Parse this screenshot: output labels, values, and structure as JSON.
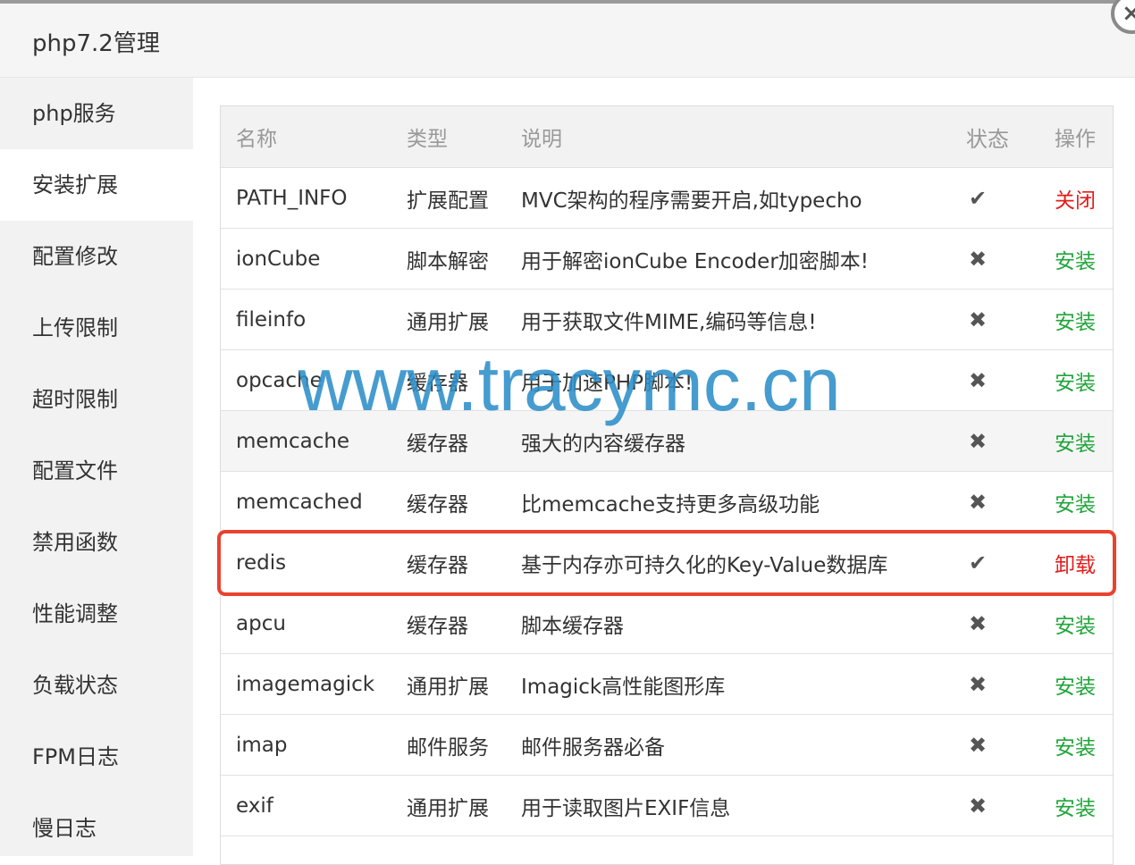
{
  "dialog": {
    "title": "php7.2管理",
    "close_icon": "×"
  },
  "sidebar": {
    "items": [
      {
        "label": "php服务"
      },
      {
        "label": "安装扩展",
        "active": true
      },
      {
        "label": "配置修改"
      },
      {
        "label": "上传限制"
      },
      {
        "label": "超时限制"
      },
      {
        "label": "配置文件"
      },
      {
        "label": "禁用函数"
      },
      {
        "label": "性能调整"
      },
      {
        "label": "负载状态"
      },
      {
        "label": "FPM日志"
      },
      {
        "label": "慢日志"
      }
    ]
  },
  "table": {
    "headers": {
      "name": "名称",
      "type": "类型",
      "desc": "说明",
      "status": "状态",
      "op": "操作"
    },
    "rows": [
      {
        "name": "PATH_INFO",
        "type": "扩展配置",
        "desc": "MVC架构的程序需要开启,如typecho",
        "status": "check",
        "status_glyph": "✔",
        "op": "关闭",
        "op_color": "#e21d1d"
      },
      {
        "name": "ionCube",
        "type": "脚本解密",
        "desc": "用于解密ionCube Encoder加密脚本!",
        "status": "cross",
        "status_glyph": "✖",
        "op": "安装",
        "op_color": "#20a53a"
      },
      {
        "name": "fileinfo",
        "type": "通用扩展",
        "desc": "用于获取文件MIME,编码等信息!",
        "status": "cross",
        "status_glyph": "✖",
        "op": "安装",
        "op_color": "#20a53a"
      },
      {
        "name": "opcache",
        "type": "缓存器",
        "desc": "用于加速PHP脚本!",
        "status": "cross",
        "status_glyph": "✖",
        "op": "安装",
        "op_color": "#20a53a"
      },
      {
        "name": "memcache",
        "type": "缓存器",
        "desc": "强大的内容缓存器",
        "status": "cross",
        "status_glyph": "✖",
        "op": "安装",
        "op_color": "#20a53a"
      },
      {
        "name": "memcached",
        "type": "缓存器",
        "desc": "比memcache支持更多高级功能",
        "status": "cross",
        "status_glyph": "✖",
        "op": "安装",
        "op_color": "#20a53a"
      },
      {
        "name": "redis",
        "type": "缓存器",
        "desc": "基于内存亦可持久化的Key-Value数据库",
        "status": "check",
        "status_glyph": "✔",
        "op": "卸载",
        "op_color": "#e21d1d"
      },
      {
        "name": "apcu",
        "type": "缓存器",
        "desc": "脚本缓存器",
        "status": "cross",
        "status_glyph": "✖",
        "op": "安装",
        "op_color": "#20a53a"
      },
      {
        "name": "imagemagick",
        "type": "通用扩展",
        "desc": "Imagick高性能图形库",
        "status": "cross",
        "status_glyph": "✖",
        "op": "安装",
        "op_color": "#20a53a"
      },
      {
        "name": "imap",
        "type": "邮件服务",
        "desc": "邮件服务器必备",
        "status": "cross",
        "status_glyph": "✖",
        "op": "安装",
        "op_color": "#20a53a"
      },
      {
        "name": "exif",
        "type": "通用扩展",
        "desc": "用于读取图片EXIF信息",
        "status": "cross",
        "status_glyph": "✖",
        "op": "安装",
        "op_color": "#20a53a"
      }
    ]
  },
  "watermark": "www.tracymc.cn",
  "colors": {
    "accent_red": "#e21d1d",
    "accent_green": "#20a53a",
    "highlight_border": "#e8432f",
    "watermark": "#2d8fc9"
  }
}
